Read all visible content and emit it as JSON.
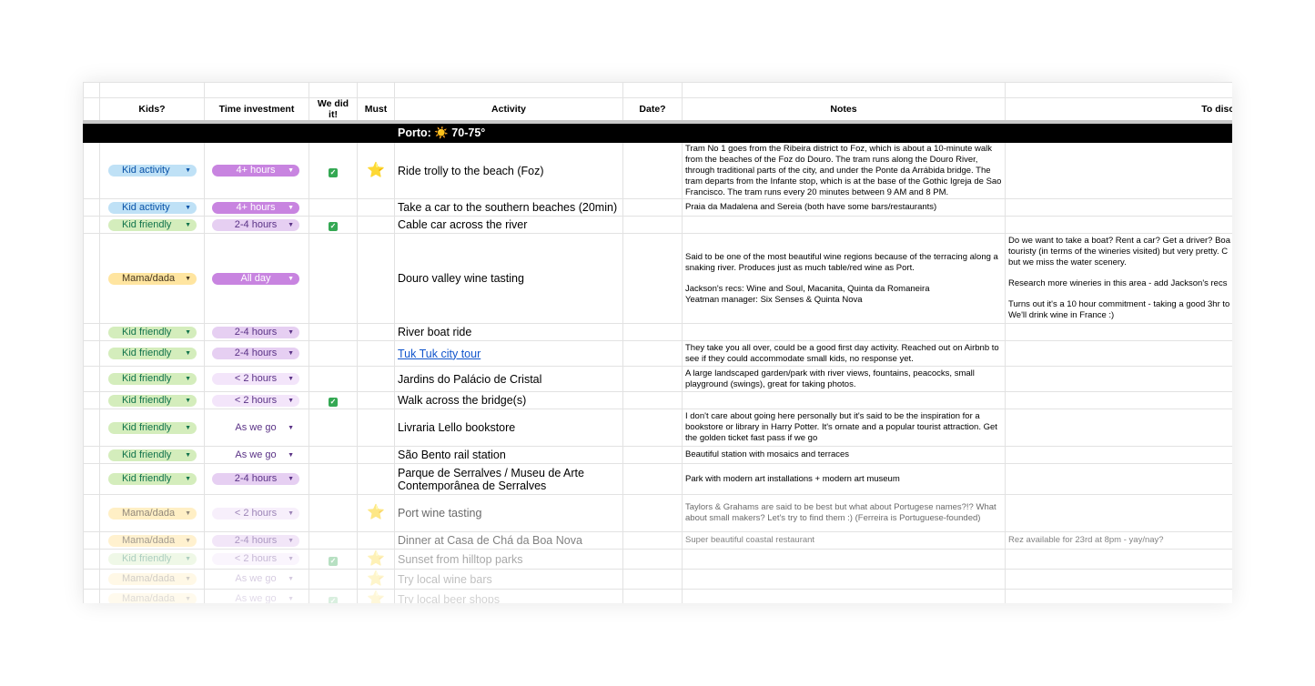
{
  "headers": {
    "kids": "Kids?",
    "time": "Time investment",
    "did": "We did it!",
    "must": "Must",
    "activity": "Activity",
    "date": "Date?",
    "notes": "Notes",
    "todo": "To discuss / to do"
  },
  "section": {
    "title": "Porto: ☀️  70-75°"
  },
  "icons": {
    "check": "✓",
    "star": "⭐",
    "dropdown_arrow": "▼"
  },
  "colors": {
    "kid_activity": "#bfe1f6",
    "kid_friendly": "#d4edbc",
    "mama_dada": "#ffe5a0",
    "time_dark": "#c884e0",
    "time_mid": "#e6cff2",
    "time_light": "#f3e5fa",
    "section_bg": "#000000",
    "link": "#1155cc"
  },
  "rows": [
    {
      "kids": "Kid activity",
      "time": "4+ hours",
      "did": true,
      "must": true,
      "activity": "Ride trolly to the beach (Foz)",
      "notes": "Tram No 1 goes from the Ribeira district to Foz, which is about a 10-minute walk from the beaches of the Foz do Douro. The tram runs along the Douro River, through traditional parts of the city, and under the Ponte da Arrábida bridge. The tram departs from the Infante stop, which is at the base of the Gothic Igreja de Sao Francisco. The tram runs every 20 minutes between 9 AM and 8 PM.",
      "todo": ""
    },
    {
      "kids": "Kid activity",
      "time": "4+ hours",
      "did": false,
      "must": false,
      "activity": "Take a car to the southern beaches (20min)",
      "notes": "Praia da Madalena and Sereia (both have some bars/restaurants)",
      "todo": ""
    },
    {
      "kids": "Kid friendly",
      "time": "2-4 hours",
      "did": true,
      "must": false,
      "activity": "Cable car across the river",
      "notes": "",
      "todo": ""
    },
    {
      "kids": "Mama/dada",
      "time": "All day",
      "did": false,
      "must": false,
      "activity": "Douro valley wine tasting",
      "notes_lines": [
        "Said to be one of the most beautiful wine regions because of the terracing along a snaking river. Produces just as much table/red wine as Port.",
        "Jackson's recs: Wine and Soul, Macanita, Quinta da Romaneira",
        "Yeatman manager: Six Senses & Quinta Nova"
      ],
      "todo_lines": [
        "Do we want to take a boat? Rent a car? Get a driver? Boa",
        "touristy (in terms of the wineries visited) but very pretty. C",
        "but we miss the water scenery.",
        "Research more wineries in this area - add Jackson's recs",
        "Turns out it's a 10 hour commitment - taking a good 3hr to",
        "We'll drink wine in France :)"
      ]
    },
    {
      "kids": "Kid friendly",
      "time": "2-4 hours",
      "did": false,
      "must": false,
      "activity": "River boat ride",
      "notes": "",
      "todo": ""
    },
    {
      "kids": "Kid friendly",
      "time": "2-4 hours",
      "did": false,
      "must": false,
      "activity": "Tuk Tuk city tour",
      "notes": "They take you all over, could be a good first day activity. Reached out on Airbnb to see if they could accommodate small kids, no response yet.",
      "todo": ""
    },
    {
      "kids": "Kid friendly",
      "time": "< 2 hours",
      "did": false,
      "must": false,
      "activity": "Jardins do Palácio de Cristal",
      "notes": "A large landscaped garden/park with river views, fountains, peacocks, small playground (swings), great for taking photos.",
      "todo": ""
    },
    {
      "kids": "Kid friendly",
      "time": "< 2 hours",
      "did": true,
      "must": false,
      "activity": "Walk across the bridge(s)",
      "notes": "",
      "todo": ""
    },
    {
      "kids": "Kid friendly",
      "time": "As we go",
      "did": false,
      "must": false,
      "activity": "Livraria Lello bookstore",
      "notes": "I don't care about going here personally but it's said to be the inspiration for a bookstore or library in Harry Potter. It's ornate and a popular tourist attraction. Get the golden ticket fast pass if we go",
      "todo": ""
    },
    {
      "kids": "Kid friendly",
      "time": "As we go",
      "did": false,
      "must": false,
      "activity": "São Bento rail station",
      "notes": "Beautiful station with mosaics and terraces",
      "todo": ""
    },
    {
      "kids": "Kid friendly",
      "time": "2-4 hours",
      "did": false,
      "must": false,
      "activity": "Parque de Serralves / Museu de Arte Contemporânea de Serralves",
      "notes": "Park with modern art installations + modern art museum",
      "todo": ""
    },
    {
      "kids": "Mama/dada",
      "time": "< 2 hours",
      "did": false,
      "must": true,
      "activity": "Port wine tasting",
      "notes": "Taylors & Grahams are said to be best but what about Portugese names?!? What about small makers? Let's try to find them :)  (Ferreira is Portuguese-founded)",
      "todo": ""
    },
    {
      "kids": "Mama/dada",
      "time": "2-4 hours",
      "did": false,
      "must": false,
      "activity": "Dinner at Casa de Chá da Boa Nova",
      "notes": "Super beautiful coastal restaurant",
      "todo": "Rez available for 23rd at 8pm - yay/nay?"
    },
    {
      "kids": "Kid friendly",
      "time": "< 2 hours",
      "did": true,
      "must": true,
      "activity": "Sunset from hilltop parks",
      "notes": "",
      "todo": ""
    },
    {
      "kids": "Mama/dada",
      "time": "As we go",
      "did": false,
      "must": true,
      "activity": "Try local wine bars",
      "notes": "",
      "todo": ""
    },
    {
      "kids": "Mama/dada",
      "time": "As we go",
      "did": true,
      "must": true,
      "activity": "Try local beer shops",
      "notes": "",
      "todo": ""
    }
  ]
}
